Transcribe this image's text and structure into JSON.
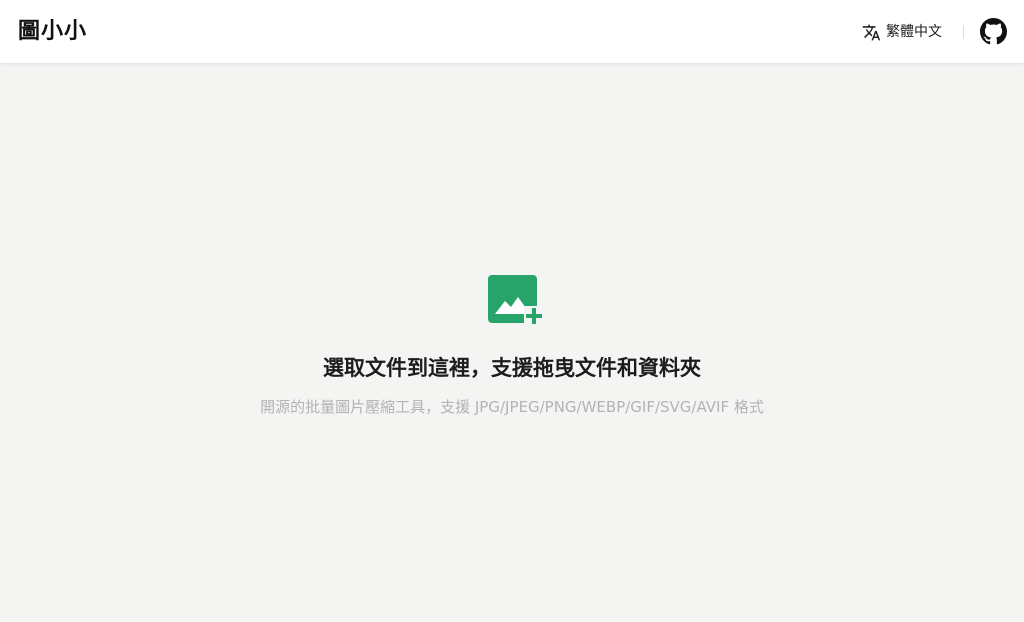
{
  "header": {
    "logo_text": "圖小小",
    "language_label": "繁體中文",
    "language_icon": "translate-icon",
    "github_icon": "github-icon"
  },
  "dropzone": {
    "icon": "add-image-icon",
    "title": "選取文件到這裡，支援拖曳文件和資料夾",
    "subtitle": "開源的批量圖片壓縮工具，支援 JPG/JPEG/PNG/WEBP/GIF/SVG/AVIF 格式"
  },
  "colors": {
    "accent": "#26a46a",
    "background": "#f4f4f3",
    "header_bg": "#ffffff",
    "title_text": "#1c1c1c",
    "subtitle_text": "#b3b3b3"
  }
}
